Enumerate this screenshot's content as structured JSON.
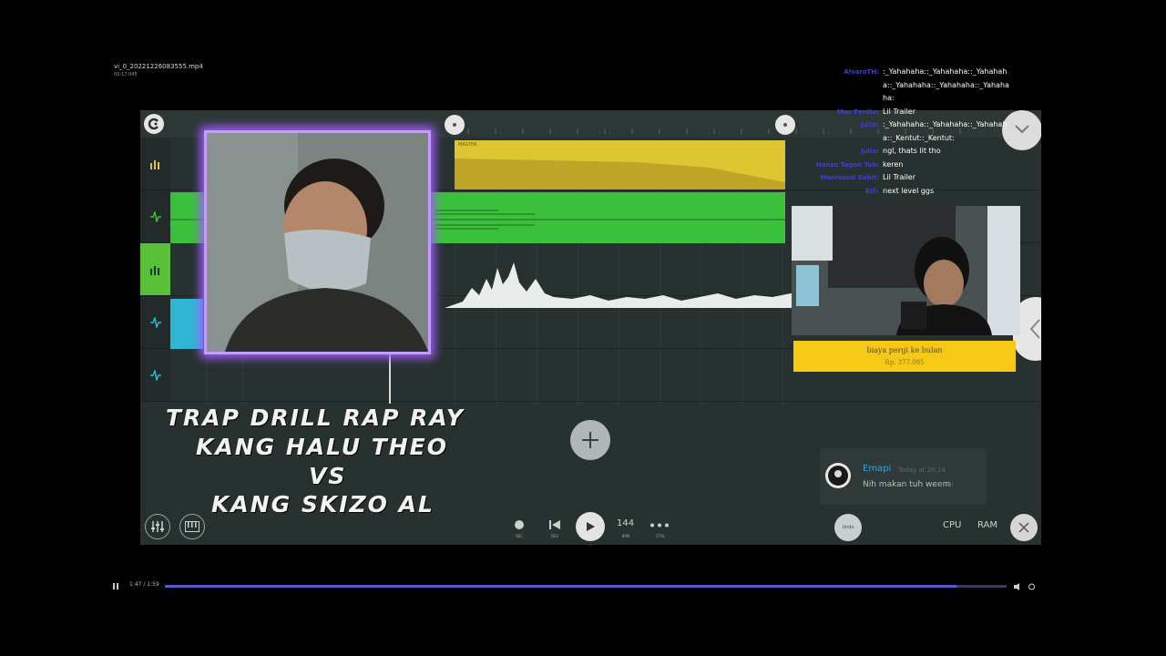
{
  "file": {
    "title": "vi_0_20221226083555.mp4",
    "subtitle": "02:17:045"
  },
  "daw": {
    "master_clip_label": "MASTER",
    "toolbar": {
      "rec_label": "REC",
      "rev_label": "REV",
      "bpm_value": "144",
      "bpm_label": "BPM",
      "ctrl_label": "CTRL",
      "undo_label": "Undo",
      "cpu_label": "CPU",
      "ram_label": "RAM"
    }
  },
  "video_title": {
    "line1": "TRAP DRILL RAP RAY",
    "line2": "KANG HALU THEO",
    "line3": "VS",
    "line4": "KANG SKIZO AL"
  },
  "chat_popup": {
    "name": "Emapi",
    "time": "Today at 20:24",
    "message": "Nih makan tuh weem",
    "edited": "(edited)"
  },
  "donation": {
    "title": "biaya pergi ke bulan",
    "amount": "Rp. 377.085"
  },
  "twitch_chat": [
    {
      "user": "AlvaroTH:",
      "text": ":_Yahahaha::_Yahahaha::_Yahahah"
    },
    {
      "user": "",
      "text": "a::_Yahahaha::_Yahahaha::_Yahaha"
    },
    {
      "user": "",
      "text": "ha:"
    },
    {
      "user": "Mas Ferdie:",
      "text": "Lil Trailer"
    },
    {
      "user": "Julia:",
      "text": ":_Yahahaha::_Yahahaha::_Yahahah"
    },
    {
      "user": "",
      "text": "a::_Kentut::_Kentut:"
    },
    {
      "user": "Julia:",
      "text": "ngl, thats lit tho"
    },
    {
      "user": "Hanzo Tagon Tab:",
      "text": "keren"
    },
    {
      "user": "Mahmoud Sabit:",
      "text": "Lil Trailer"
    },
    {
      "user": "Bill:",
      "text": "next level ggs"
    }
  ],
  "player": {
    "time": "1:47 / 1:59",
    "progress": 0.94
  },
  "colors": {
    "daw_bg": "#27312f",
    "master_clip": "#e0c533",
    "audio_clip": "#3bc03c",
    "active_track": "#57c13a",
    "cyan_clip": "#2fb6d3",
    "frame_glow": "#a15cff",
    "donation_bg": "#f5c915"
  }
}
